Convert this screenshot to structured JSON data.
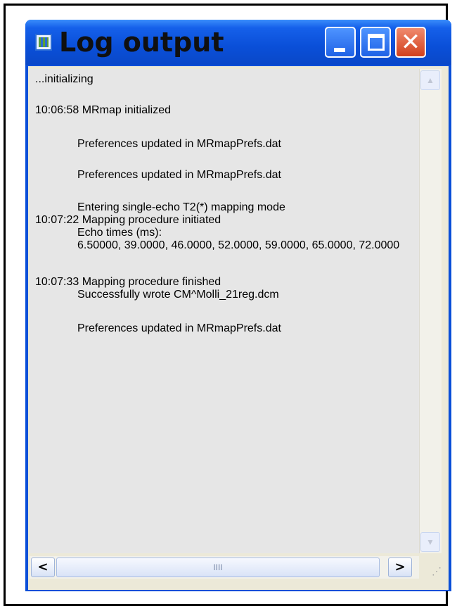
{
  "window": {
    "title": "Log output",
    "controls": {
      "minimize_icon": "minimize-icon",
      "maximize_icon": "maximize-icon",
      "close_icon": "close-icon"
    },
    "close_glyph": "✕"
  },
  "log": {
    "lines": [
      "...initializing",
      "10:06:58   MRmap initialized",
      "Preferences updated in MRmapPrefs.dat",
      "Preferences updated in MRmapPrefs.dat",
      "Entering single-echo T2(*) mapping mode",
      "10:07:22   Mapping procedure initiated",
      "Echo times (ms):",
      "6.50000, 39.0000, 46.0000, 52.0000, 59.0000, 65.0000, 72.0000",
      "10:07:33   Mapping procedure finished",
      "Successfully wrote CM^Molli_21reg.dcm",
      "Preferences updated in MRmapPrefs.dat"
    ]
  },
  "scrollbars": {
    "up_glyph": "▲",
    "down_glyph": "▼",
    "left_glyph": "<",
    "right_glyph": ">",
    "thumb_grip": "IIII",
    "size_grip": "⋰"
  },
  "colors": {
    "titlebar": "#0a4fd8",
    "close_button": "#d1401c",
    "log_background": "#e6e6e6"
  }
}
